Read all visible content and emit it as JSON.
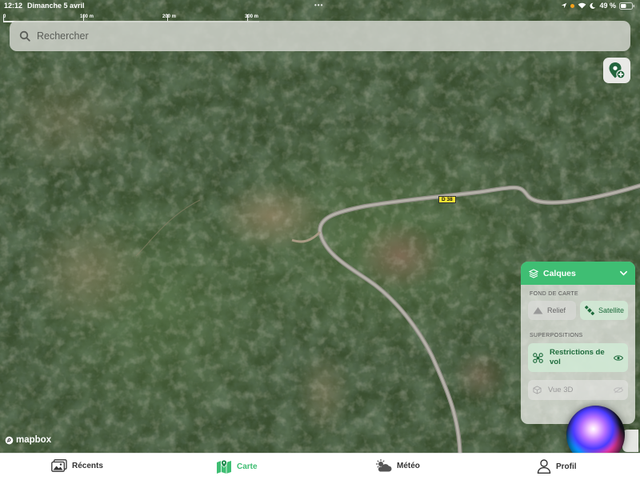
{
  "status": {
    "time": "12:12",
    "date": "Dimanche 5 avril",
    "battery": "49 %",
    "dots": "•••"
  },
  "scale": {
    "labels": [
      "0",
      "100 m",
      "200 m",
      "300 m"
    ]
  },
  "search": {
    "placeholder": "Rechercher"
  },
  "map": {
    "road_label": "D 38",
    "attribution": "mapbox"
  },
  "layers_panel": {
    "title": "Calques",
    "base_section": "FOND DE CARTE",
    "relief": "Relief",
    "satellite": "Satellite",
    "overlay_section": "SUPERPOSITIONS",
    "restrictions": "Restrictions de vol",
    "view3d": "Vue 3D"
  },
  "tabs": [
    {
      "label": "Récents",
      "icon": "photos-icon"
    },
    {
      "label": "Carte",
      "icon": "map-icon"
    },
    {
      "label": "Météo",
      "icon": "weather-icon"
    },
    {
      "label": "Profil",
      "icon": "person-icon"
    }
  ],
  "colors": {
    "accent": "#3fbe73",
    "road_label_bg": "#f2e233"
  }
}
